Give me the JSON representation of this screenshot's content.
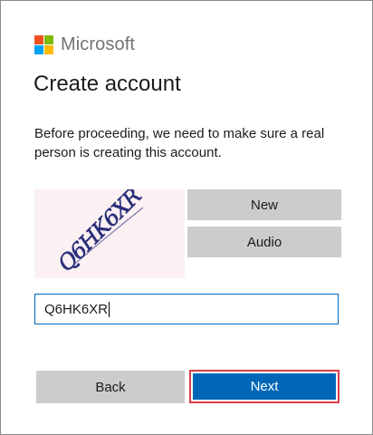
{
  "brand": {
    "name": "Microsoft"
  },
  "page": {
    "title": "Create account",
    "description": "Before proceeding, we need to make sure a real person is creating this account."
  },
  "captcha": {
    "image_text": "Q6HK6XR",
    "new_label": "New",
    "audio_label": "Audio"
  },
  "input": {
    "value": "Q6HK6XR"
  },
  "actions": {
    "back_label": "Back",
    "next_label": "Next"
  },
  "colors": {
    "logo_red": "#f25022",
    "logo_green": "#7fba00",
    "logo_blue": "#00a4ef",
    "logo_yellow": "#ffb900",
    "primary": "#0067b8",
    "focus_outline": "#d6404b",
    "secondary_button": "#cccccc"
  }
}
